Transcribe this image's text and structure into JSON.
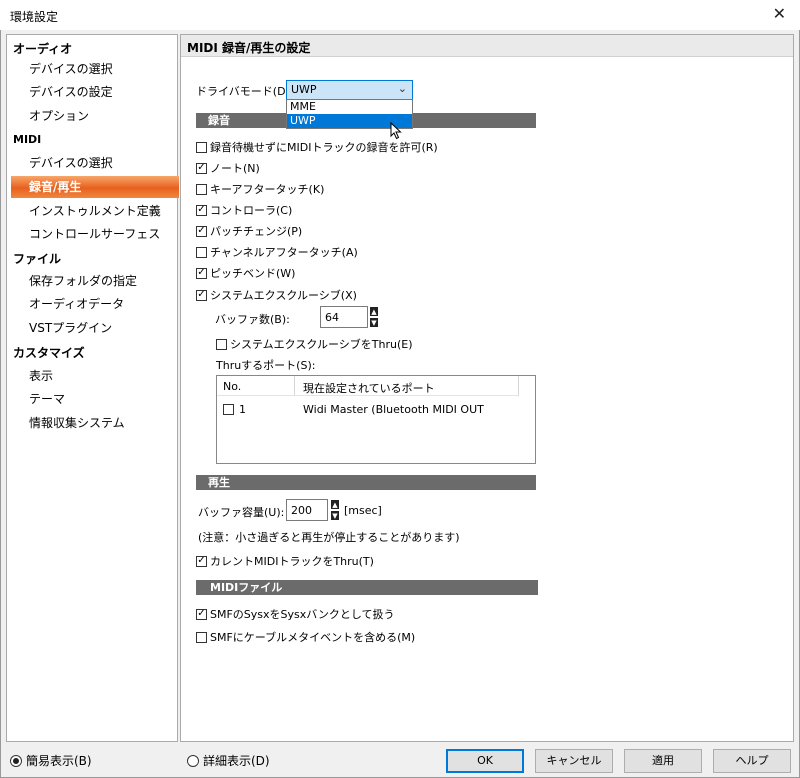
{
  "window": {
    "title": "環境設定"
  },
  "sidebar": {
    "groups": [
      {
        "label": "オーディオ",
        "items": [
          "デバイスの選択",
          "デバイスの設定",
          "オプション"
        ]
      },
      {
        "label": "MIDI",
        "items": [
          "デバイスの選択",
          "録音/再生",
          "インストゥルメント定義",
          "コントロールサーフェス"
        ]
      },
      {
        "label": "ファイル",
        "items": [
          "保存フォルダの指定",
          "オーディオデータ",
          "VSTプラグイン"
        ]
      },
      {
        "label": "カスタマイズ",
        "items": [
          "表示",
          "テーマ",
          "情報収集システム"
        ]
      }
    ],
    "active_item": "録音/再生"
  },
  "panel": {
    "title": "MIDI 録音/再生の設定",
    "driver_mode": {
      "label": "ドライバモード(D):",
      "value": "UWP",
      "options": [
        "MME",
        "UWP"
      ]
    },
    "recording": {
      "header": "録音",
      "checkboxes": [
        {
          "label": "録音待機せずにMIDIトラックの録音を許可(R)",
          "checked": false
        },
        {
          "label": "ノート(N)",
          "checked": true
        },
        {
          "label": "キーアフタータッチ(K)",
          "checked": false
        },
        {
          "label": "コントローラ(C)",
          "checked": true
        },
        {
          "label": "パッチチェンジ(P)",
          "checked": true
        },
        {
          "label": "チャンネルアフタータッチ(A)",
          "checked": false
        },
        {
          "label": "ピッチベンド(W)",
          "checked": true
        },
        {
          "label": "システムエクスクルーシブ(X)",
          "checked": true
        }
      ],
      "buffer_count_label": "バッファ数(B):",
      "buffer_count_value": "64",
      "sysex_thru": {
        "label": "システムエクスクルーシブをThru(E)",
        "checked": false
      },
      "thru_ports_label": "Thruするポート(S):",
      "ports_table": {
        "columns": [
          "No.",
          "現在設定されているポート"
        ],
        "rows": [
          {
            "no": "1",
            "port": "Widi Master (Bluetooth MIDI OUT",
            "checked": false
          }
        ]
      }
    },
    "playback": {
      "header": "再生",
      "buffer_label": "バッファ容量(U):",
      "buffer_value": "200",
      "buffer_unit": "[msec]",
      "note": "(注意：小さ過ぎると再生が停止することがあります)",
      "current_thru": {
        "label": "カレントMIDIトラックをThru(T)",
        "checked": true
      }
    },
    "midi_file": {
      "header": "MIDIファイル",
      "checkboxes": [
        {
          "label": "SMFのSysxをSysxバンクとして扱う",
          "checked": true
        },
        {
          "label": "SMFにケーブルメタイベントを含める(M)",
          "checked": false
        }
      ]
    }
  },
  "footer": {
    "simple_view": {
      "label": "簡易表示(B)",
      "selected": true
    },
    "detail_view": {
      "label": "詳細表示(D)",
      "selected": false
    },
    "buttons": [
      "OK",
      "キャンセル",
      "適用",
      "ヘルプ"
    ]
  }
}
